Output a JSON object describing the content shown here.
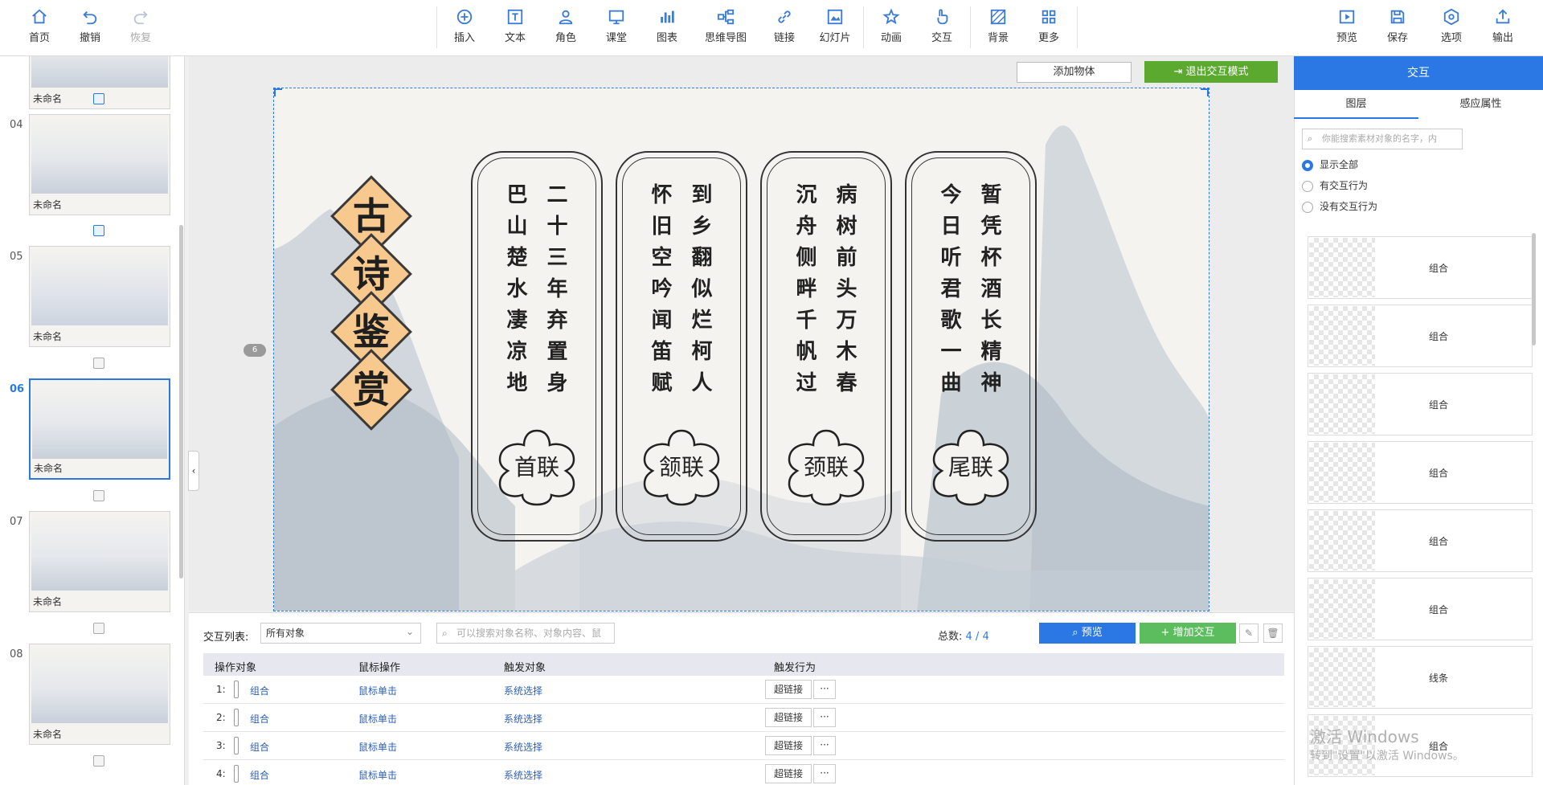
{
  "toolbar": {
    "home": "首页",
    "undo": "撤销",
    "redo": "恢复",
    "insert": "插入",
    "text": "文本",
    "role": "角色",
    "classroom": "课堂",
    "chart": "图表",
    "mindmap": "思维导图",
    "link": "链接",
    "slideshow": "幻灯片",
    "animation": "动画",
    "interaction": "交互",
    "background": "背景",
    "more": "更多",
    "preview": "预览",
    "save": "保存",
    "options": "选项",
    "export": "输出"
  },
  "slides": [
    {
      "num": "",
      "name": "未命名"
    },
    {
      "num": "04",
      "name": "未命名"
    },
    {
      "num": "05",
      "name": "未命名"
    },
    {
      "num": "06",
      "name": "未命名"
    },
    {
      "num": "07",
      "name": "未命名"
    },
    {
      "num": "08",
      "name": "未命名"
    }
  ],
  "canvas": {
    "add_object": "添加物体",
    "exit_interaction": "退出交互模式",
    "page_indicator": "6",
    "title_chars": [
      "古",
      "诗",
      "鉴",
      "赏"
    ],
    "cards": [
      {
        "right": "二十三年弃置身",
        "left": "巴山楚水凄凉地",
        "seal": "首联"
      },
      {
        "right": "到乡翻似烂柯人",
        "left": "怀旧空吟闻笛赋",
        "seal": "颔联"
      },
      {
        "right": "病树前头万木春",
        "left": "沉舟侧畔千帆过",
        "seal": "颈联"
      },
      {
        "right": "暂凭杯酒长精神",
        "left": "今日听君歌一曲",
        "seal": "尾联"
      }
    ]
  },
  "interaction_list": {
    "label": "交互列表:",
    "filter": "所有对象",
    "search_placeholder": "可以搜索对象名称、对象内容、鼠",
    "total_label": "总数:",
    "total_value": "4 / 4",
    "preview": "预览",
    "add": "增加交互",
    "columns": [
      "操作对象",
      "鼠标操作",
      "触发对象",
      "触发行为"
    ],
    "rows": [
      {
        "idx": "1:",
        "object": "组合",
        "mouse": "鼠标单击",
        "target": "系统选择",
        "action": "超链接"
      },
      {
        "idx": "2:",
        "object": "组合",
        "mouse": "鼠标单击",
        "target": "系统选择",
        "action": "超链接"
      },
      {
        "idx": "3:",
        "object": "组合",
        "mouse": "鼠标单击",
        "target": "系统选择",
        "action": "超链接"
      },
      {
        "idx": "4:",
        "object": "组合",
        "mouse": "鼠标单击",
        "target": "系统选择",
        "action": "超链接"
      }
    ]
  },
  "right_panel": {
    "title": "交互",
    "tab_layers": "图层",
    "tab_properties": "感应属性",
    "search_placeholder": "你能搜索素材对象的名字，内",
    "filter_all": "显示全部",
    "filter_with": "有交互行为",
    "filter_without": "没有交互行为",
    "layers": [
      "组合",
      "组合",
      "组合",
      "组合",
      "组合",
      "组合",
      "线条",
      "组合"
    ]
  },
  "watermark": {
    "line1": "激活 Windows",
    "line2": "转到\"设置\"以激活 Windows。"
  }
}
